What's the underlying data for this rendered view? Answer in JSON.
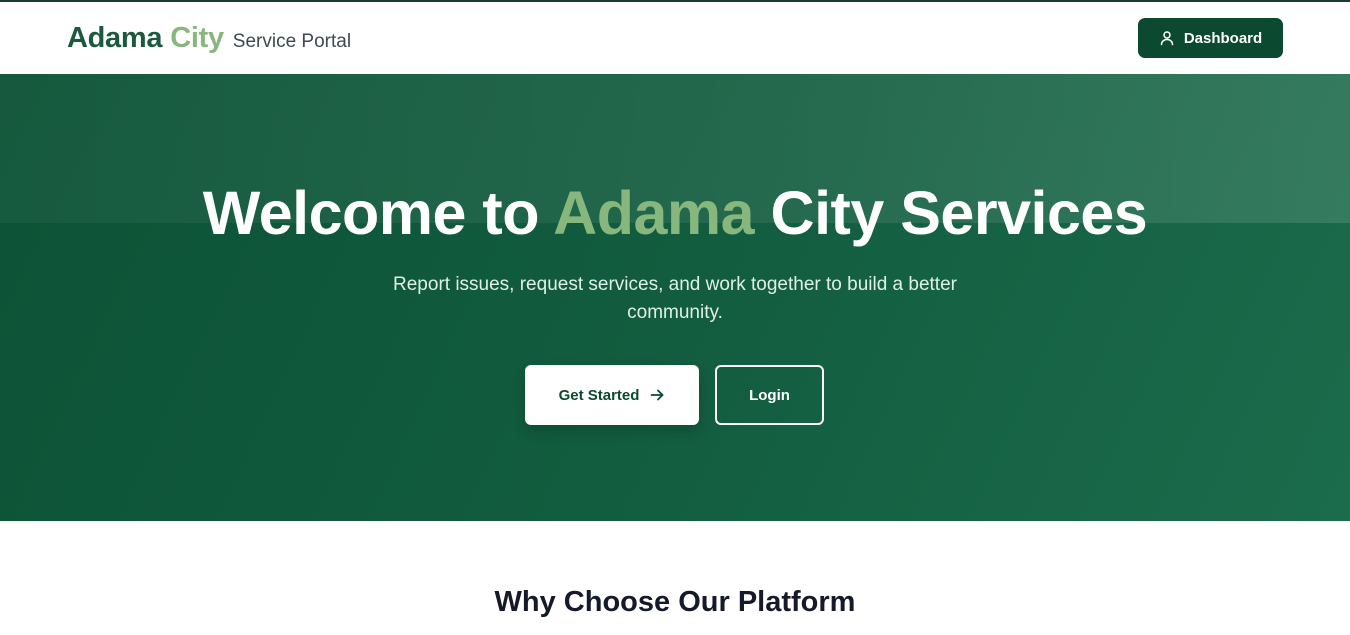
{
  "header": {
    "brand_primary": "Adama",
    "brand_secondary": "City",
    "brand_sub": "Service Portal",
    "dashboard_label": "Dashboard",
    "dashboard_icon": "user-icon"
  },
  "hero": {
    "title_part1": "Welcome to",
    "title_accent": "Adama",
    "title_part2": "City Services",
    "subtitle": "Report issues, request services, and work together to build a better community.",
    "get_started_label": "Get Started",
    "get_started_icon": "arrow-right-icon",
    "login_label": "Login"
  },
  "section": {
    "title": "Why Choose Our Platform"
  },
  "colors": {
    "brand_dark": "#0b4a30",
    "brand_accent": "#87b77c",
    "hero_bg": "#125c3f"
  }
}
